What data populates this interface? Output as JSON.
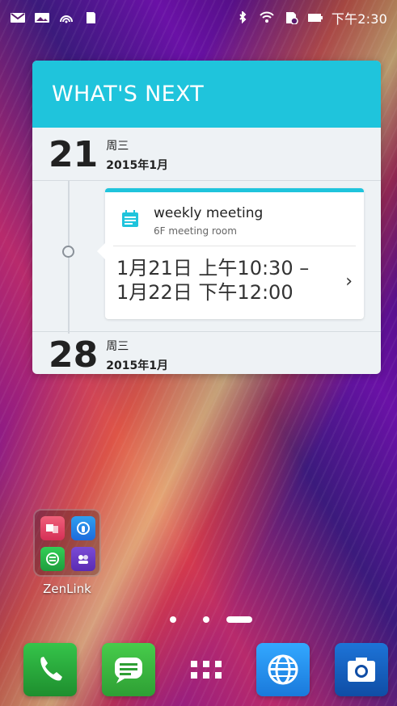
{
  "status_bar": {
    "time": "下午2:30",
    "left_icons": [
      "mail-icon",
      "image-icon",
      "nfc-icon",
      "sd-card-icon"
    ],
    "right_icons": [
      "bluetooth-icon",
      "wifi-icon",
      "sim-icon",
      "battery-icon"
    ]
  },
  "widget": {
    "title": "WHAT'S NEXT",
    "day1": {
      "day": "21",
      "weekday": "周三",
      "date": "2015年1月"
    },
    "event": {
      "title": "weekly meeting",
      "location": "6F meeting room",
      "time_line1": "1月21日 上午10:30 –",
      "time_line2": "1月22日 下午12:00"
    },
    "day2": {
      "day": "28",
      "weekday": "周三",
      "date": "2015年1月"
    }
  },
  "folder": {
    "label": "ZenLink",
    "apps": [
      "share-link-icon",
      "remote-link-icon",
      "party-link-icon",
      "pc-link-icon"
    ]
  },
  "pager": {
    "pages": 3,
    "current": 3
  },
  "dock": {
    "items": [
      "phone-icon",
      "messages-icon",
      "apps-grid-icon",
      "browser-icon",
      "camera-icon"
    ]
  },
  "colors": {
    "widget_header": "#1fc4dc",
    "widget_bg": "#eef2f5"
  }
}
